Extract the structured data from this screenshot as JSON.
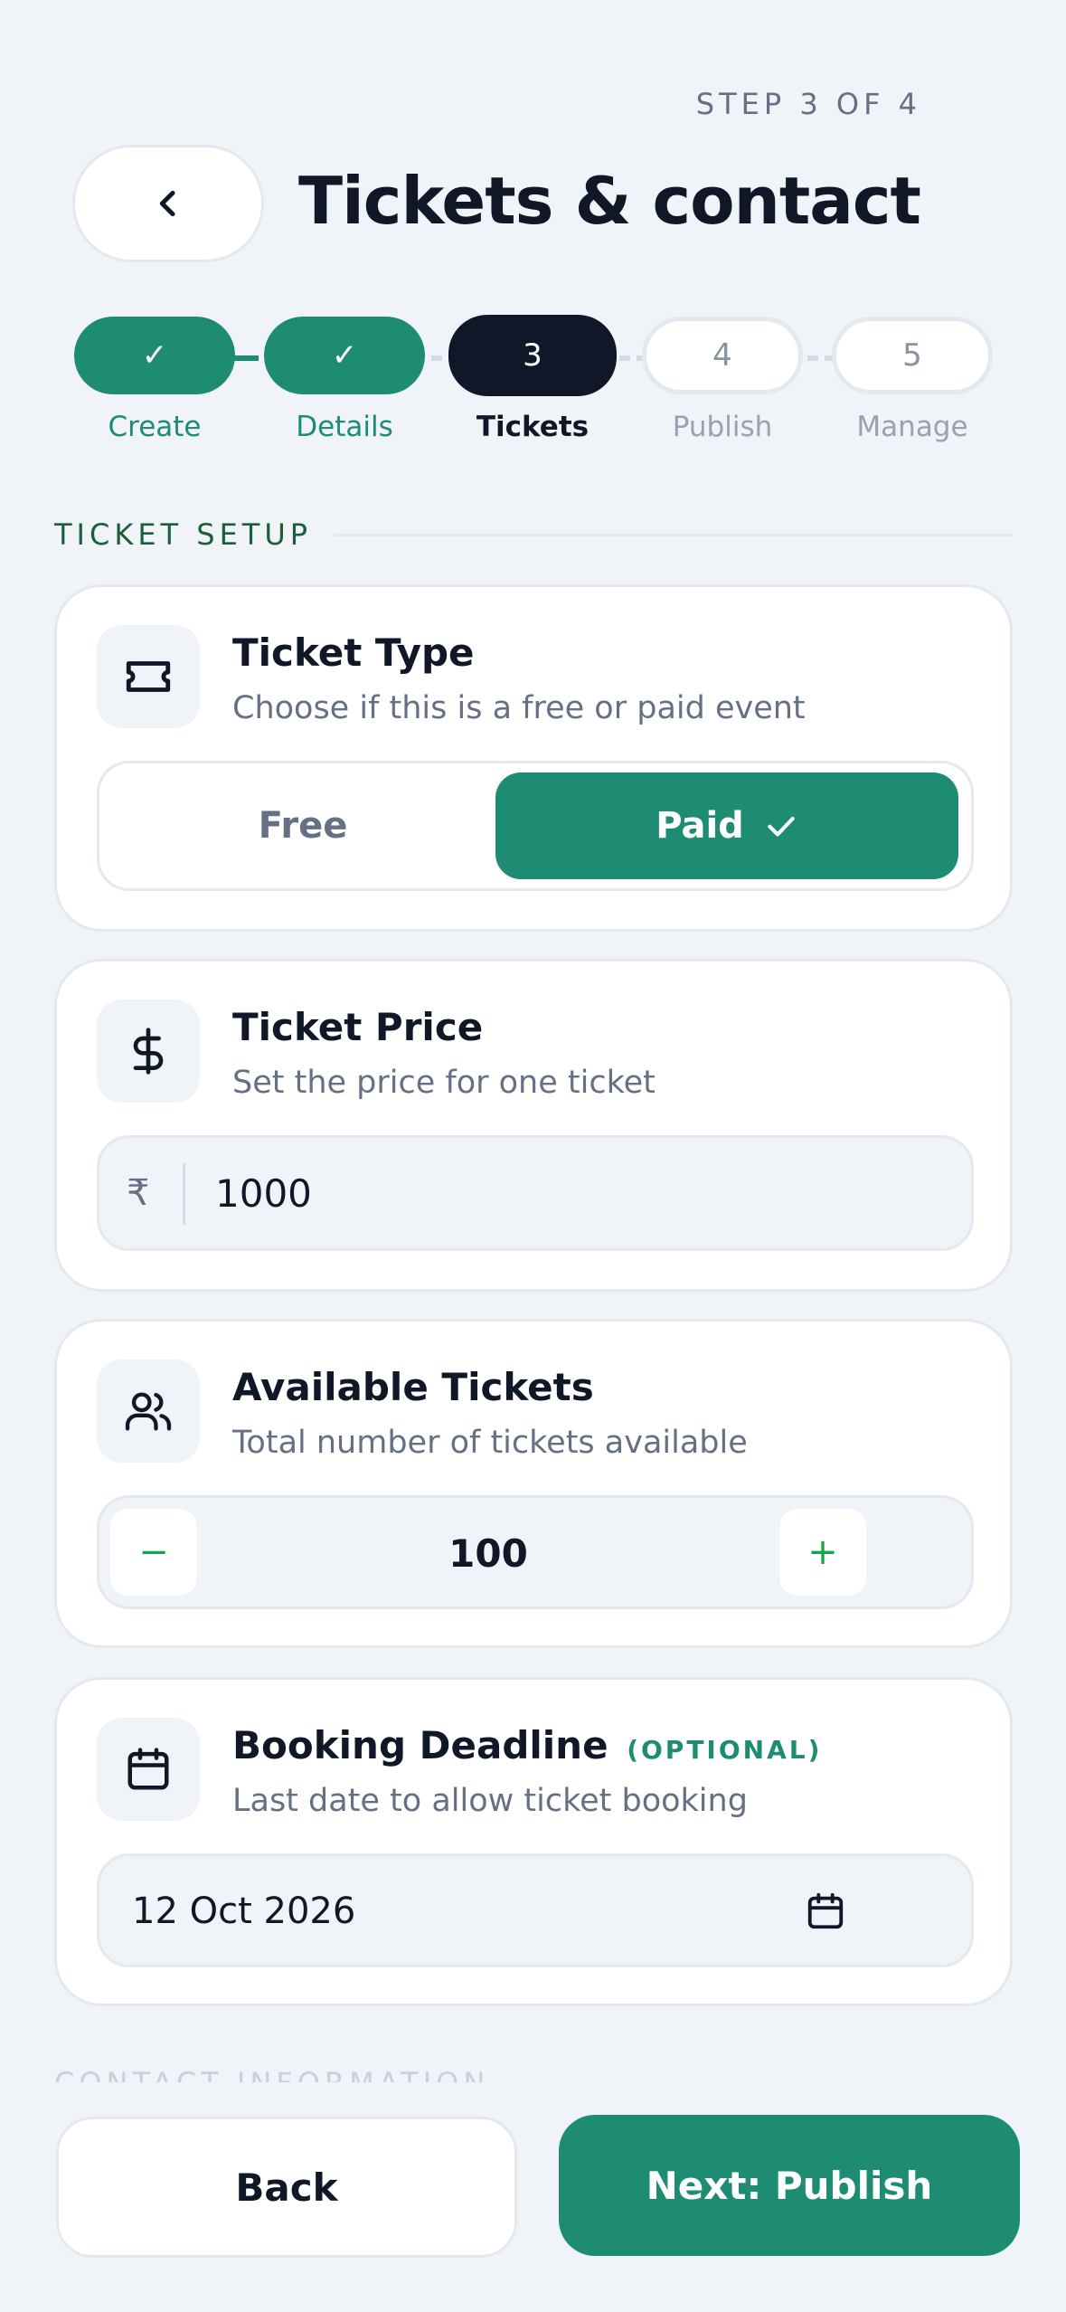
{
  "header": {
    "step_indicator": "STEP 3 OF 4",
    "title": "Tickets & contact"
  },
  "stepper": {
    "steps": [
      {
        "mark": "✓",
        "label": "Create",
        "state": "done"
      },
      {
        "mark": "✓",
        "label": "Details",
        "state": "done"
      },
      {
        "mark": "3",
        "label": "Tickets",
        "state": "active"
      },
      {
        "mark": "4",
        "label": "Publish",
        "state": "todo"
      },
      {
        "mark": "5",
        "label": "Manage",
        "state": "todo"
      }
    ]
  },
  "section": {
    "title": "TICKET SETUP",
    "next_title": "CONTACT INFORMATION"
  },
  "ticket_type": {
    "title": "Ticket Type",
    "subtitle": "Choose if this is a free or paid event",
    "icon": "ticket-icon",
    "options": {
      "free": "Free",
      "paid": "Paid"
    },
    "selected": "paid"
  },
  "ticket_price": {
    "title": "Ticket Price",
    "subtitle": "Set the price for one ticket",
    "icon": "dollar-icon",
    "currency_symbol": "₹",
    "value": "1000"
  },
  "available_tickets": {
    "title": "Available Tickets",
    "subtitle": "Total number of tickets available",
    "icon": "users-icon",
    "minus": "−",
    "plus": "+",
    "value": "100"
  },
  "booking_deadline": {
    "title": "Booking Deadline",
    "optional_tag": "(OPTIONAL)",
    "subtitle": "Last date to allow ticket booking",
    "icon": "calendar-icon",
    "value": "12 Oct 2026"
  },
  "footer": {
    "back_label": "Back",
    "next_label": "Next: Publish"
  },
  "colors": {
    "accent": "#1e8c73",
    "dark": "#0f1729",
    "background": "#f0f3f8"
  }
}
